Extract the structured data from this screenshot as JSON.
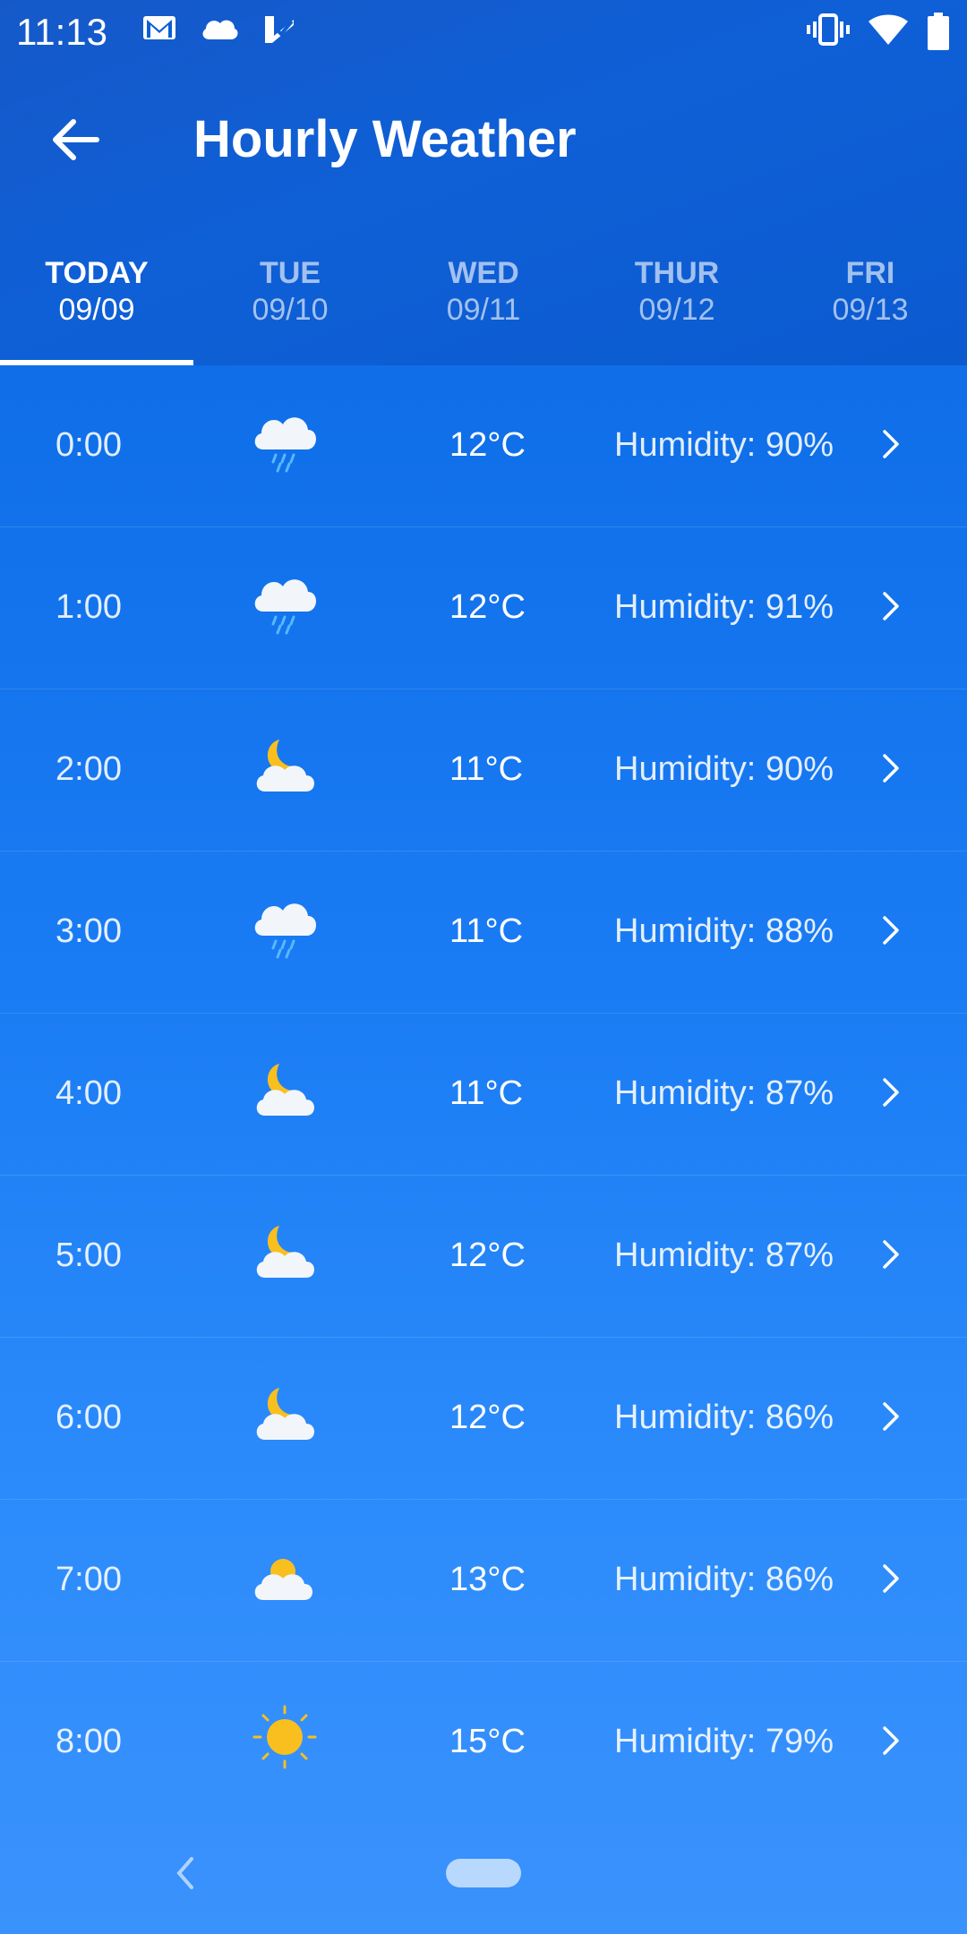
{
  "status_bar": {
    "time": "11:13",
    "icons": [
      "gmail-icon",
      "cloud-icon",
      "checkmark-app-icon",
      "vibrate-icon",
      "wifi-icon",
      "battery-icon"
    ]
  },
  "app_bar": {
    "title": "Hourly Weather"
  },
  "tabs": [
    {
      "day": "TODAY",
      "date": "09/09",
      "active": true
    },
    {
      "day": "TUE",
      "date": "09/10",
      "active": false
    },
    {
      "day": "WED",
      "date": "09/11",
      "active": false
    },
    {
      "day": "THUR",
      "date": "09/12",
      "active": false
    },
    {
      "day": "FRI",
      "date": "09/13",
      "active": false
    }
  ],
  "hours": [
    {
      "time": "0:00",
      "icon": "rain-cloud-icon",
      "temp": "12°C",
      "humidity": "Humidity: 90%"
    },
    {
      "time": "1:00",
      "icon": "rain-cloud-icon",
      "temp": "12°C",
      "humidity": "Humidity: 91%"
    },
    {
      "time": "2:00",
      "icon": "moon-cloud-icon",
      "temp": "11°C",
      "humidity": "Humidity: 90%"
    },
    {
      "time": "3:00",
      "icon": "rain-cloud-icon",
      "temp": "11°C",
      "humidity": "Humidity: 88%"
    },
    {
      "time": "4:00",
      "icon": "moon-cloud-icon",
      "temp": "11°C",
      "humidity": "Humidity: 87%"
    },
    {
      "time": "5:00",
      "icon": "moon-cloud-icon",
      "temp": "12°C",
      "humidity": "Humidity: 87%"
    },
    {
      "time": "6:00",
      "icon": "moon-cloud-icon",
      "temp": "12°C",
      "humidity": "Humidity: 86%"
    },
    {
      "time": "7:00",
      "icon": "sun-cloud-icon",
      "temp": "13°C",
      "humidity": "Humidity: 86%"
    },
    {
      "time": "8:00",
      "icon": "sun-icon",
      "temp": "15°C",
      "humidity": "Humidity: 79%"
    }
  ],
  "colors": {
    "sun": "#f8bf1f",
    "cloud": "#f2f6fb",
    "rain": "#5ab8ff"
  }
}
